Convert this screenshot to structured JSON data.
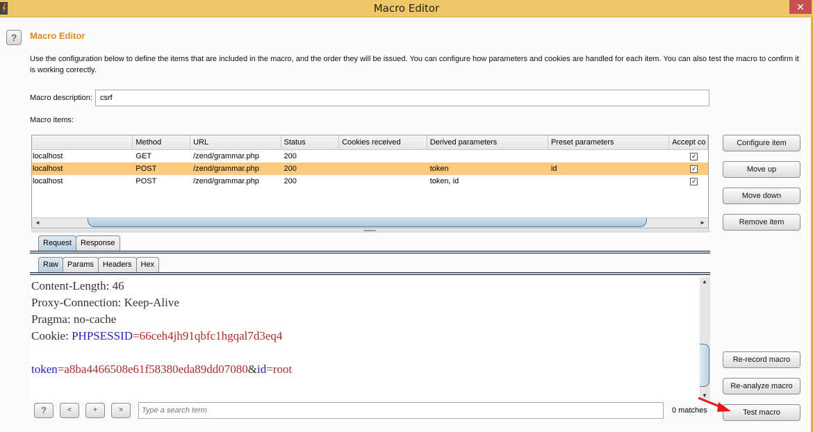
{
  "window": {
    "title": "Macro Editor",
    "close_glyph": "✕"
  },
  "header": {
    "help_glyph": "?",
    "heading": "Macro Editor",
    "intro": "Use the configuration below to define the items that are included in the macro, and the order they will be issued. You can configure how parameters and cookies are handled for each item. You can also test the macro to confirm it is working correctly."
  },
  "description": {
    "label": "Macro description:",
    "value": "csrf"
  },
  "items": {
    "label": "Macro items:",
    "columns": [
      "",
      "Method",
      "URL",
      "Status",
      "Cookies received",
      "Derived parameters",
      "Preset parameters",
      "Accept co"
    ],
    "rows": [
      {
        "host": "localhost",
        "method": "GET",
        "url": "/zend/grammar.php",
        "status": "200",
        "cookies": "",
        "derived": "",
        "preset": "",
        "accept": true,
        "selected": false
      },
      {
        "host": "localhost",
        "method": "POST",
        "url": "/zend/grammar.php",
        "status": "200",
        "cookies": "",
        "derived": "token",
        "preset": "id",
        "accept": true,
        "selected": true
      },
      {
        "host": "localhost",
        "method": "POST",
        "url": "/zend/grammar.php",
        "status": "200",
        "cookies": "",
        "derived": "token, id",
        "preset": "",
        "accept": true,
        "selected": false
      }
    ],
    "check_glyph": "✓"
  },
  "side_buttons": {
    "configure": "Configure item",
    "move_up": "Move up",
    "move_down": "Move down",
    "remove": "Remove item",
    "rerecord": "Re-record macro",
    "reanalyze": "Re-analyze macro",
    "test": "Test macro"
  },
  "tabs": {
    "outer": [
      "Request",
      "Response"
    ],
    "outer_active": "Request",
    "inner": [
      "Raw",
      "Params",
      "Headers",
      "Hex"
    ],
    "inner_active": "Raw"
  },
  "request": {
    "lines": [
      {
        "text": "Content-Length: 46"
      },
      {
        "text": "Proxy-Connection: Keep-Alive"
      },
      {
        "text": "Pragma: no-cache"
      },
      {
        "prefix": "Cookie: ",
        "key": "PHPSESSID",
        "eq": "=",
        "value": "66ceh4jh91qbfc1hgqal7d3eq4"
      },
      {
        "text": ""
      },
      {
        "key": "token",
        "eq": "=",
        "value": "a8ba4466508e61f58380eda89dd07080",
        "amp": "&",
        "key2": "id",
        "eq2": "=",
        "value2": "root"
      }
    ]
  },
  "search": {
    "help": "?",
    "prev": "<",
    "add": "+",
    "next": ">",
    "placeholder": "Type a search term",
    "matches": "0 matches"
  },
  "scroll": {
    "left": "◄",
    "right": "►",
    "up": "▲",
    "down": "▼"
  }
}
